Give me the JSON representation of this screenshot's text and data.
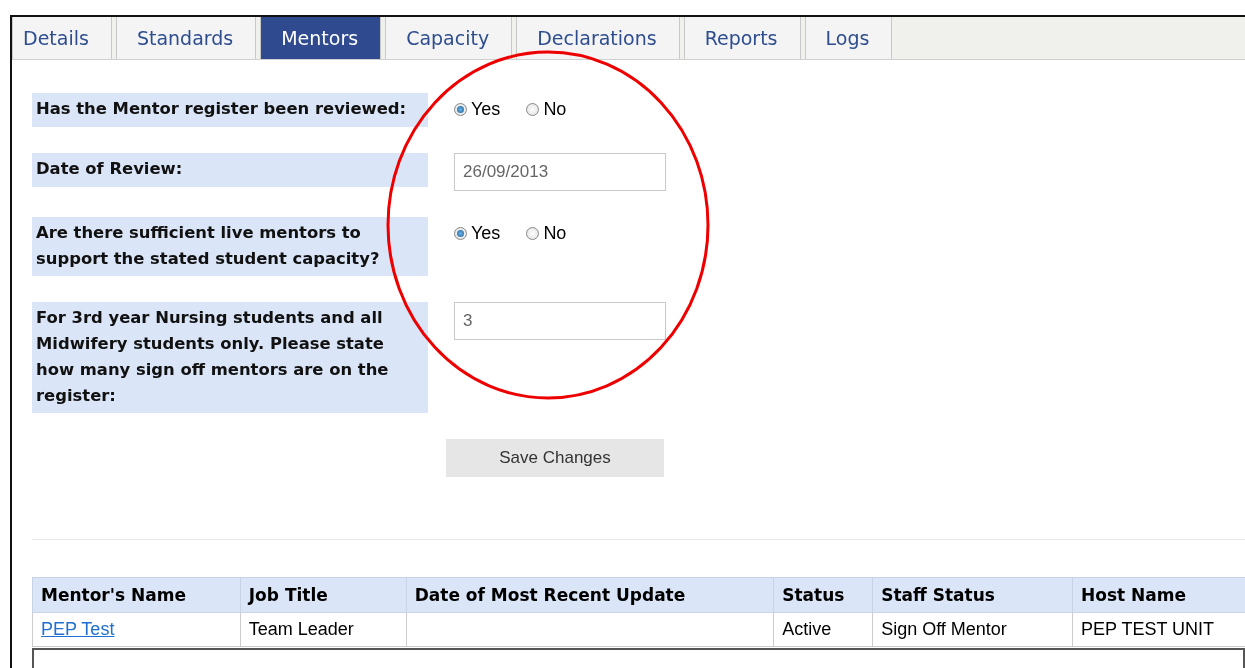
{
  "tabs": [
    {
      "label": "Details",
      "selected": false
    },
    {
      "label": "Standards",
      "selected": false
    },
    {
      "label": "Mentors",
      "selected": true
    },
    {
      "label": "Capacity",
      "selected": false
    },
    {
      "label": "Declarations",
      "selected": false
    },
    {
      "label": "Reports",
      "selected": false
    },
    {
      "label": "Logs",
      "selected": false
    }
  ],
  "form": [
    {
      "kind": "radio",
      "label": "Has the Mentor register been reviewed:",
      "options": [
        {
          "label": "Yes",
          "selected": true
        },
        {
          "label": "No",
          "selected": false
        }
      ]
    },
    {
      "kind": "input",
      "label": "Date of Review:",
      "value": "26/09/2013"
    },
    {
      "kind": "radio",
      "label": "Are there sufficient live mentors to support the stated student capacity?",
      "options": [
        {
          "label": "Yes",
          "selected": true
        },
        {
          "label": "No",
          "selected": false
        }
      ]
    },
    {
      "kind": "input",
      "label": "For 3rd year Nursing students and all Midwifery students only. Please state how many sign off mentors are on the register:",
      "value": "3"
    }
  ],
  "save_button": "Save Changes",
  "table": {
    "columns": [
      "Mentor's Name",
      "Job Title",
      "Date of Most Recent Update",
      "Status",
      "Staff Status",
      "Host Name"
    ],
    "rows": [
      [
        "PEP Test",
        "Team Leader",
        "",
        "Active",
        "Sign Off Mentor",
        "PEP TEST UNIT"
      ]
    ]
  }
}
